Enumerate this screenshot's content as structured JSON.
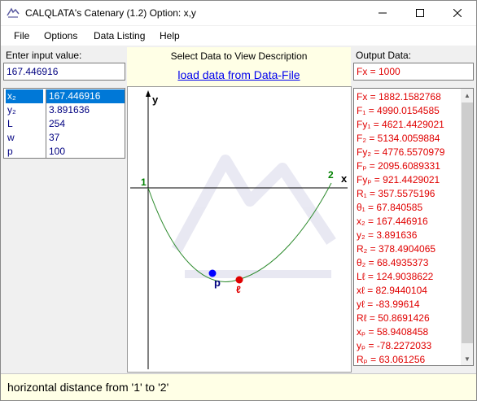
{
  "window": {
    "title": "CALQLATA's  Catenary (1.2)  Option: x,y",
    "minimize": "—",
    "maximize": "☐",
    "close": "✕"
  },
  "menu": [
    "File",
    "Options",
    "Data Listing",
    "Help"
  ],
  "input": {
    "label": "Enter input value:",
    "value": "167.446916"
  },
  "variables": [
    {
      "name": "x₂",
      "value": "167.446916",
      "selected": true
    },
    {
      "name": "y₂",
      "value": "3.891636",
      "selected": false
    },
    {
      "name": "L",
      "value": "254",
      "selected": false
    },
    {
      "name": "w",
      "value": "37",
      "selected": false
    },
    {
      "name": "p",
      "value": "100",
      "selected": false
    }
  ],
  "center": {
    "select_label": "Select Data to View Description",
    "load_link": "load data from Data-File"
  },
  "plot": {
    "y_axis": "y",
    "x_axis": "x",
    "point1": "1",
    "point2": "2",
    "point_p": "p",
    "point_l": "ℓ",
    "colors": {
      "curve": "#2e8b2e",
      "p": "#0000ff",
      "l": "#e00000",
      "labels12": "#008000"
    }
  },
  "output": {
    "label": "Output Data:",
    "value": "Fx = 1000",
    "items": [
      "Fx = 1882.1582768",
      "F₁ = 4990.0154585",
      "Fy₁ = 4621.4429021",
      "F₂ = 5134.0059884",
      "Fy₂ = 4776.5570979",
      "Fₚ = 2095.6089331",
      "Fyₚ = 921.4429021",
      "R₁ = 357.5575196",
      "θ₁ = 67.840585",
      "x₂ = 167.446916",
      "y₂ = 3.891636",
      "R₂ = 378.4904065",
      "θ₂ = 68.4935373",
      "Lℓ = 124.9038622",
      "xℓ = 82.9440104",
      "yℓ = -83.99614",
      "Rℓ = 50.8691426",
      "xₚ = 58.9408458",
      "yₚ = -78.2272033",
      "Rₚ = 63.061256"
    ]
  },
  "status": "horizontal distance from '1' to '2'"
}
